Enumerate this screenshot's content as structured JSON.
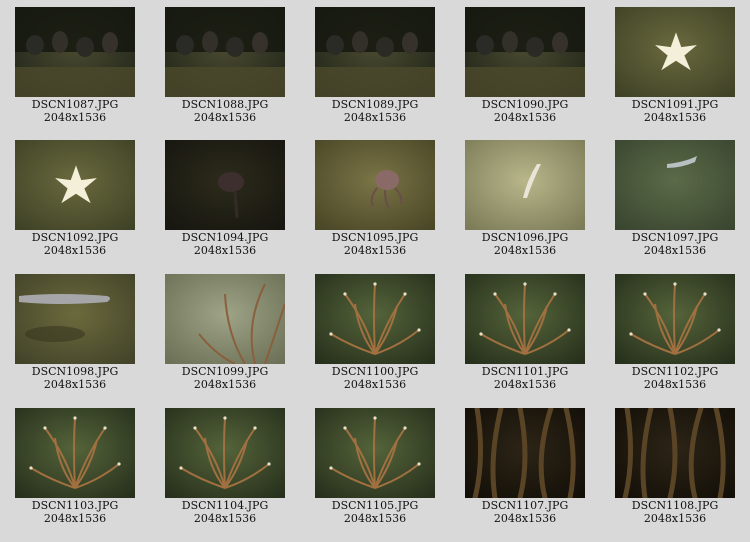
{
  "gallery": {
    "thumbnails": [
      {
        "filename": "DSCN1087.JPG",
        "dimensions": "2048x1536",
        "subject": "dark-rocky-ledge"
      },
      {
        "filename": "DSCN1088.JPG",
        "dimensions": "2048x1536",
        "subject": "dark-rocky-ledge"
      },
      {
        "filename": "DSCN1089.JPG",
        "dimensions": "2048x1536",
        "subject": "dark-rocky-ledge"
      },
      {
        "filename": "DSCN1090.JPG",
        "dimensions": "2048x1536",
        "subject": "dark-rocky-ledge"
      },
      {
        "filename": "DSCN1091.JPG",
        "dimensions": "2048x1536",
        "subject": "white-starfish"
      },
      {
        "filename": "DSCN1092.JPG",
        "dimensions": "2048x1536",
        "subject": "white-starfish"
      },
      {
        "filename": "DSCN1094.JPG",
        "dimensions": "2048x1536",
        "subject": "dark-seafloor-creature"
      },
      {
        "filename": "DSCN1095.JPG",
        "dimensions": "2048x1536",
        "subject": "octopus-on-rock"
      },
      {
        "filename": "DSCN1096.JPG",
        "dimensions": "2048x1536",
        "subject": "pale-fish-sand"
      },
      {
        "filename": "DSCN1097.JPG",
        "dimensions": "2048x1536",
        "subject": "fish-green-seafloor"
      },
      {
        "filename": "DSCN1098.JPG",
        "dimensions": "2048x1536",
        "subject": "grey-fish"
      },
      {
        "filename": "DSCN1099.JPG",
        "dimensions": "2048x1536",
        "subject": "coral-bush-light"
      },
      {
        "filename": "DSCN1100.JPG",
        "dimensions": "2048x1536",
        "subject": "coral-bush"
      },
      {
        "filename": "DSCN1101.JPG",
        "dimensions": "2048x1536",
        "subject": "coral-bush"
      },
      {
        "filename": "DSCN1102.JPG",
        "dimensions": "2048x1536",
        "subject": "coral-bush"
      },
      {
        "filename": "DSCN1103.JPG",
        "dimensions": "2048x1536",
        "subject": "coral-bush"
      },
      {
        "filename": "DSCN1104.JPG",
        "dimensions": "2048x1536",
        "subject": "coral-bush"
      },
      {
        "filename": "DSCN1105.JPG",
        "dimensions": "2048x1536",
        "subject": "coral-bush"
      },
      {
        "filename": "DSCN1107.JPG",
        "dimensions": "2048x1536",
        "subject": "dark-tube-worms"
      },
      {
        "filename": "DSCN1108.JPG",
        "dimensions": "2048x1536",
        "subject": "dark-tube-worms"
      }
    ]
  }
}
